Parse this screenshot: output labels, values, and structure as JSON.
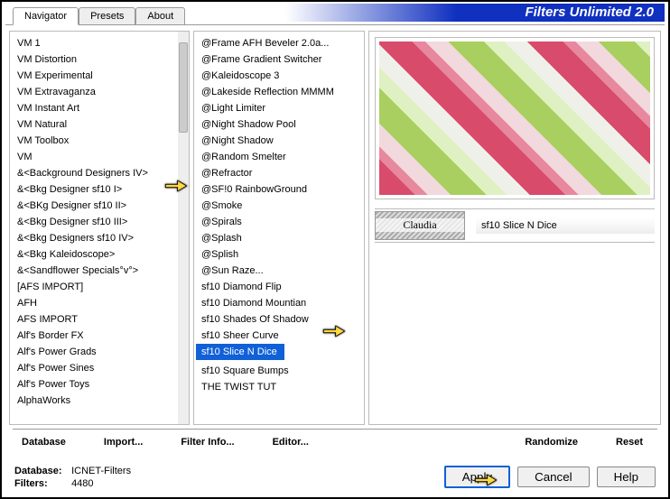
{
  "title": "Filters Unlimited 2.0",
  "tabs": [
    "Navigator",
    "Presets",
    "About"
  ],
  "categories": [
    "VM 1",
    "VM Distortion",
    "VM Experimental",
    "VM Extravaganza",
    "VM Instant Art",
    "VM Natural",
    "VM Toolbox",
    "VM",
    "&<Background Designers IV>",
    "&<Bkg Designer sf10 I>",
    "&<BKg Designer sf10 II>",
    "&<Bkg Designer sf10 III>",
    "&<Bkg Designers sf10 IV>",
    "&<Bkg Kaleidoscope>",
    "&<Sandflower Specials°v°>",
    "[AFS IMPORT]",
    "AFH",
    "AFS IMPORT",
    "Alf's Border FX",
    "Alf's Power Grads",
    "Alf's Power Sines",
    "Alf's Power Toys",
    "AlphaWorks"
  ],
  "categories_selected_index": 8,
  "filters": [
    "@Frame AFH Beveler 2.0a...",
    "@Frame Gradient Switcher",
    "@Kaleidoscope 3",
    "@Lakeside Reflection MMMM",
    "@Light Limiter",
    "@Night Shadow Pool",
    "@Night Shadow",
    "@Random Smelter",
    "@Refractor",
    "@SF!0 RainbowGround",
    "@Smoke",
    "@Spirals",
    "@Splash",
    "@Splish",
    "@Sun Raze...",
    "sf10 Diamond Flip",
    "sf10 Diamond Mountian",
    "sf10 Shades Of Shadow",
    "sf10 Sheer Curve",
    "sf10 Slice N Dice",
    "sf10 Square Bumps",
    "THE TWIST TUT"
  ],
  "filters_selected_index": 19,
  "selected_filter_name": "sf10 Slice N Dice",
  "bottom_buttons": {
    "database": "Database",
    "import": "Import...",
    "filter_info": "Filter Info...",
    "editor": "Editor...",
    "randomize": "Randomize",
    "reset": "Reset"
  },
  "action_buttons": {
    "apply": "Apply",
    "cancel": "Cancel",
    "help": "Help"
  },
  "status": {
    "database_label": "Database:",
    "database_value": "ICNET-Filters",
    "filters_label": "Filters:",
    "filters_value": "4480"
  }
}
